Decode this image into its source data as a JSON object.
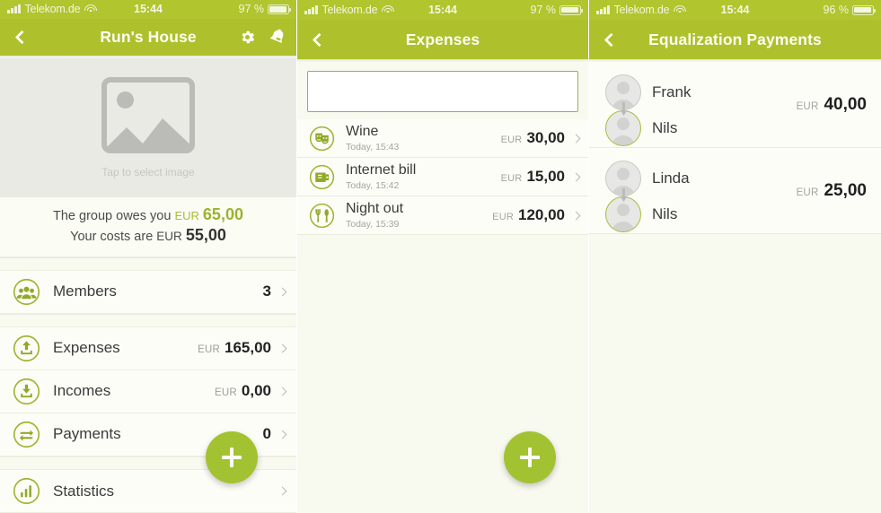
{
  "colors": {
    "status_bar_green": "#b0c52e",
    "nav_green": "#aec02c",
    "accent_green": "#a3c232",
    "list_bg": "#fdfdf7",
    "page_bg": "#f8f9ef"
  },
  "screens": [
    {
      "id": "group-detail",
      "status": {
        "carrier": "Telekom.de",
        "time": "15:44",
        "battery": "97 %",
        "wifi_icon": "wifi-icon",
        "signal_icon": "signal-bars-icon",
        "battery_icon": "battery-icon"
      },
      "nav": {
        "back_icon": "chevron-left-icon",
        "title": "Run's House",
        "actions": [
          {
            "icon": "gear-icon",
            "name": "settings-button"
          },
          {
            "icon": "bell-icon",
            "name": "notifications-button"
          }
        ]
      },
      "hero": {
        "placeholder_icon": "image-placeholder-icon",
        "caption": "Tap to select image"
      },
      "balance": {
        "owes_prefix": "The group owes you",
        "owes_currency": "EUR",
        "owes_amount": "65,00",
        "costs_prefix": "Your costs are",
        "costs_currency": "EUR",
        "costs_amount": "55,00"
      },
      "rows_group_a": [
        {
          "icon": "members-icon",
          "label": "Members",
          "currency": "",
          "value": "3",
          "chevron": "chevron-right-icon"
        }
      ],
      "rows_group_b": [
        {
          "icon": "expenses-upload-icon",
          "label": "Expenses",
          "currency": "EUR",
          "value": "165,00",
          "chevron": "chevron-right-icon"
        },
        {
          "icon": "incomes-download-icon",
          "label": "Incomes",
          "currency": "EUR",
          "value": "0,00",
          "chevron": "chevron-right-icon"
        },
        {
          "icon": "payments-exchange-icon",
          "label": "Payments",
          "currency": "",
          "value": "0",
          "chevron": "chevron-right-icon"
        }
      ],
      "rows_group_c": [
        {
          "icon": "statistics-bars-icon",
          "label": "Statistics",
          "currency": "",
          "value": "",
          "chevron": "chevron-right-icon"
        }
      ],
      "fab": {
        "icon": "plus-icon",
        "name": "add-button"
      }
    },
    {
      "id": "expenses-list",
      "status": {
        "carrier": "Telekom.de",
        "time": "15:44",
        "battery": "97 %",
        "wifi_icon": "wifi-icon",
        "signal_icon": "signal-bars-icon",
        "battery_icon": "battery-icon"
      },
      "nav": {
        "back_icon": "chevron-left-icon",
        "title": "Expenses",
        "actions": []
      },
      "search": {
        "value": "",
        "placeholder": ""
      },
      "expenses": [
        {
          "icon": "theater-masks-icon",
          "title": "Wine",
          "subtitle": "Today, 15:43",
          "currency": "EUR",
          "value": "30,00",
          "chevron": "chevron-right-icon"
        },
        {
          "icon": "wallet-icon",
          "title": "Internet bill",
          "subtitle": "Today, 15:42",
          "currency": "EUR",
          "value": "15,00",
          "chevron": "chevron-right-icon"
        },
        {
          "icon": "cutlery-icon",
          "title": "Night out",
          "subtitle": "Today, 15:39",
          "currency": "EUR",
          "value": "120,00",
          "chevron": "chevron-right-icon"
        }
      ],
      "fab": {
        "icon": "plus-icon",
        "name": "add-expense-button"
      }
    },
    {
      "id": "equalization-payments",
      "status": {
        "carrier": "Telekom.de",
        "time": "15:44",
        "battery": "96 %",
        "wifi_icon": "wifi-icon",
        "signal_icon": "signal-bars-icon",
        "battery_icon": "battery-icon"
      },
      "nav": {
        "back_icon": "chevron-left-icon",
        "title": "Equalization Payments",
        "actions": []
      },
      "payments": [
        {
          "from": "Frank",
          "to": "Nils",
          "currency": "EUR",
          "value": "40,00",
          "arrow_icon": "arrow-down-icon"
        },
        {
          "from": "Linda",
          "to": "Nils",
          "currency": "EUR",
          "value": "25,00",
          "arrow_icon": "arrow-down-icon"
        }
      ]
    }
  ]
}
